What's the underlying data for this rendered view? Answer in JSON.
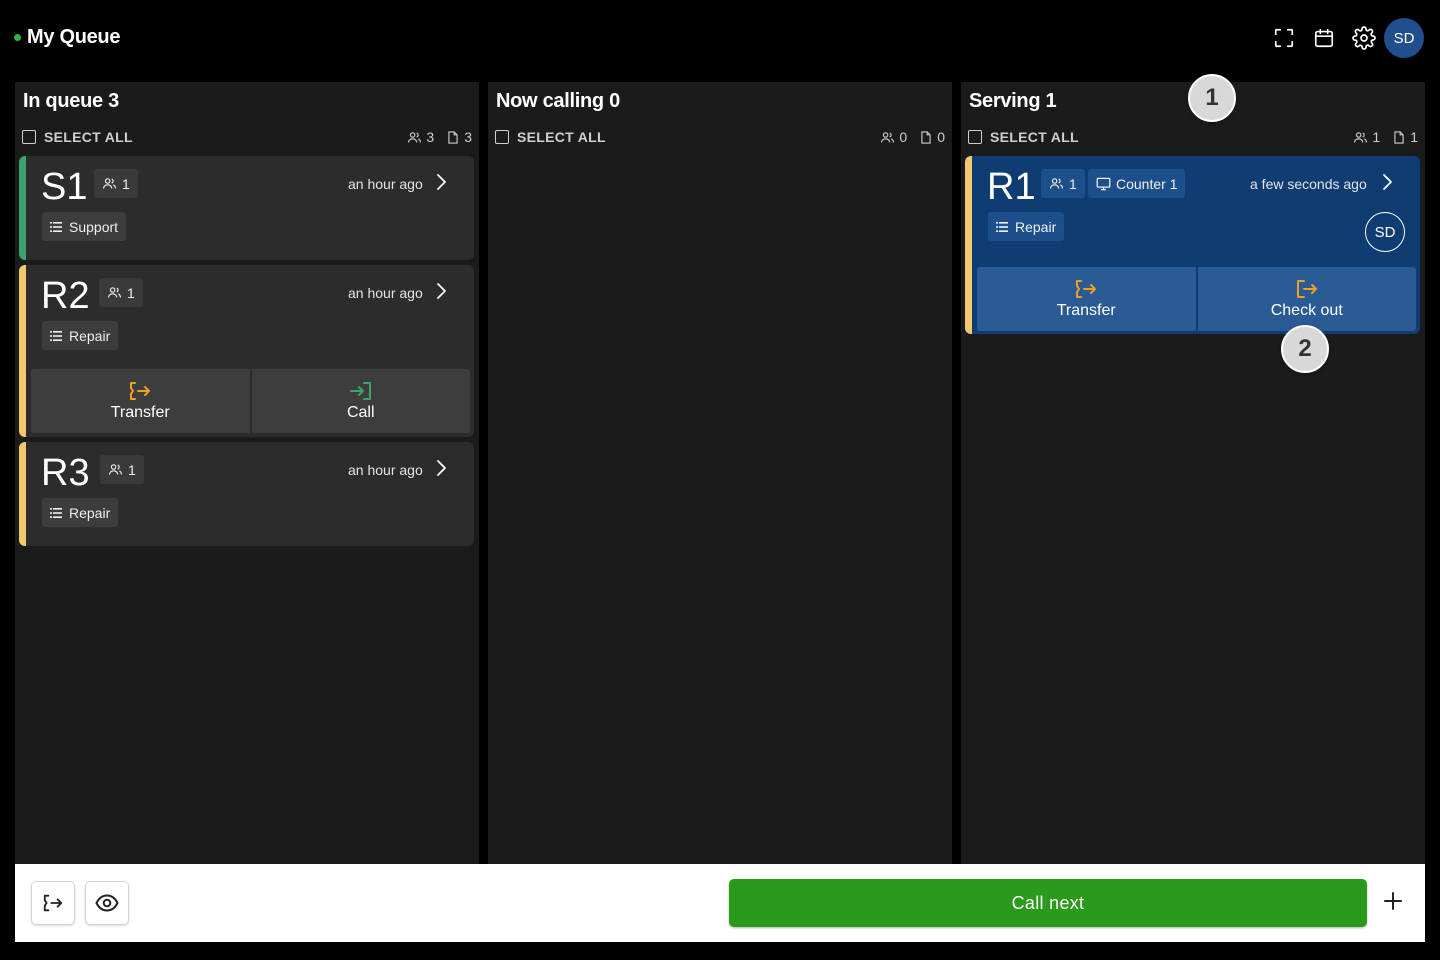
{
  "header": {
    "title": "My Queue",
    "avatar_initials": "SD"
  },
  "colors": {
    "accent_green": "#2a9a1c",
    "stripe_green": "#3aa36a",
    "stripe_yellow": "#f3c970",
    "serving_blue": "#0f3d73",
    "transfer_orange": "#f0a020"
  },
  "columns": [
    {
      "title": "In queue 3",
      "select_all": "SELECT ALL",
      "people_count": "3",
      "ticket_count": "3",
      "cards": [
        {
          "id": "S1",
          "people": "1",
          "time": "an hour ago",
          "service": "Support",
          "stripe": "green"
        },
        {
          "id": "R2",
          "people": "1",
          "time": "an hour ago",
          "service": "Repair",
          "stripe": "yellow",
          "actions": [
            "Transfer",
            "Call"
          ]
        },
        {
          "id": "R3",
          "people": "1",
          "time": "an hour ago",
          "service": "Repair",
          "stripe": "yellow"
        }
      ]
    },
    {
      "title": "Now calling 0",
      "select_all": "SELECT ALL",
      "people_count": "0",
      "ticket_count": "0",
      "cards": []
    },
    {
      "title": "Serving 1",
      "select_all": "SELECT ALL",
      "people_count": "1",
      "ticket_count": "1",
      "cards": [
        {
          "id": "R1",
          "people": "1",
          "counter": "Counter 1",
          "time": "a few seconds ago",
          "service": "Repair",
          "stripe": "yellow",
          "avatar": "SD",
          "actions": [
            "Transfer",
            "Check out"
          ]
        }
      ]
    }
  ],
  "callouts": [
    "1",
    "2"
  ],
  "footer": {
    "call_next": "Call next"
  }
}
